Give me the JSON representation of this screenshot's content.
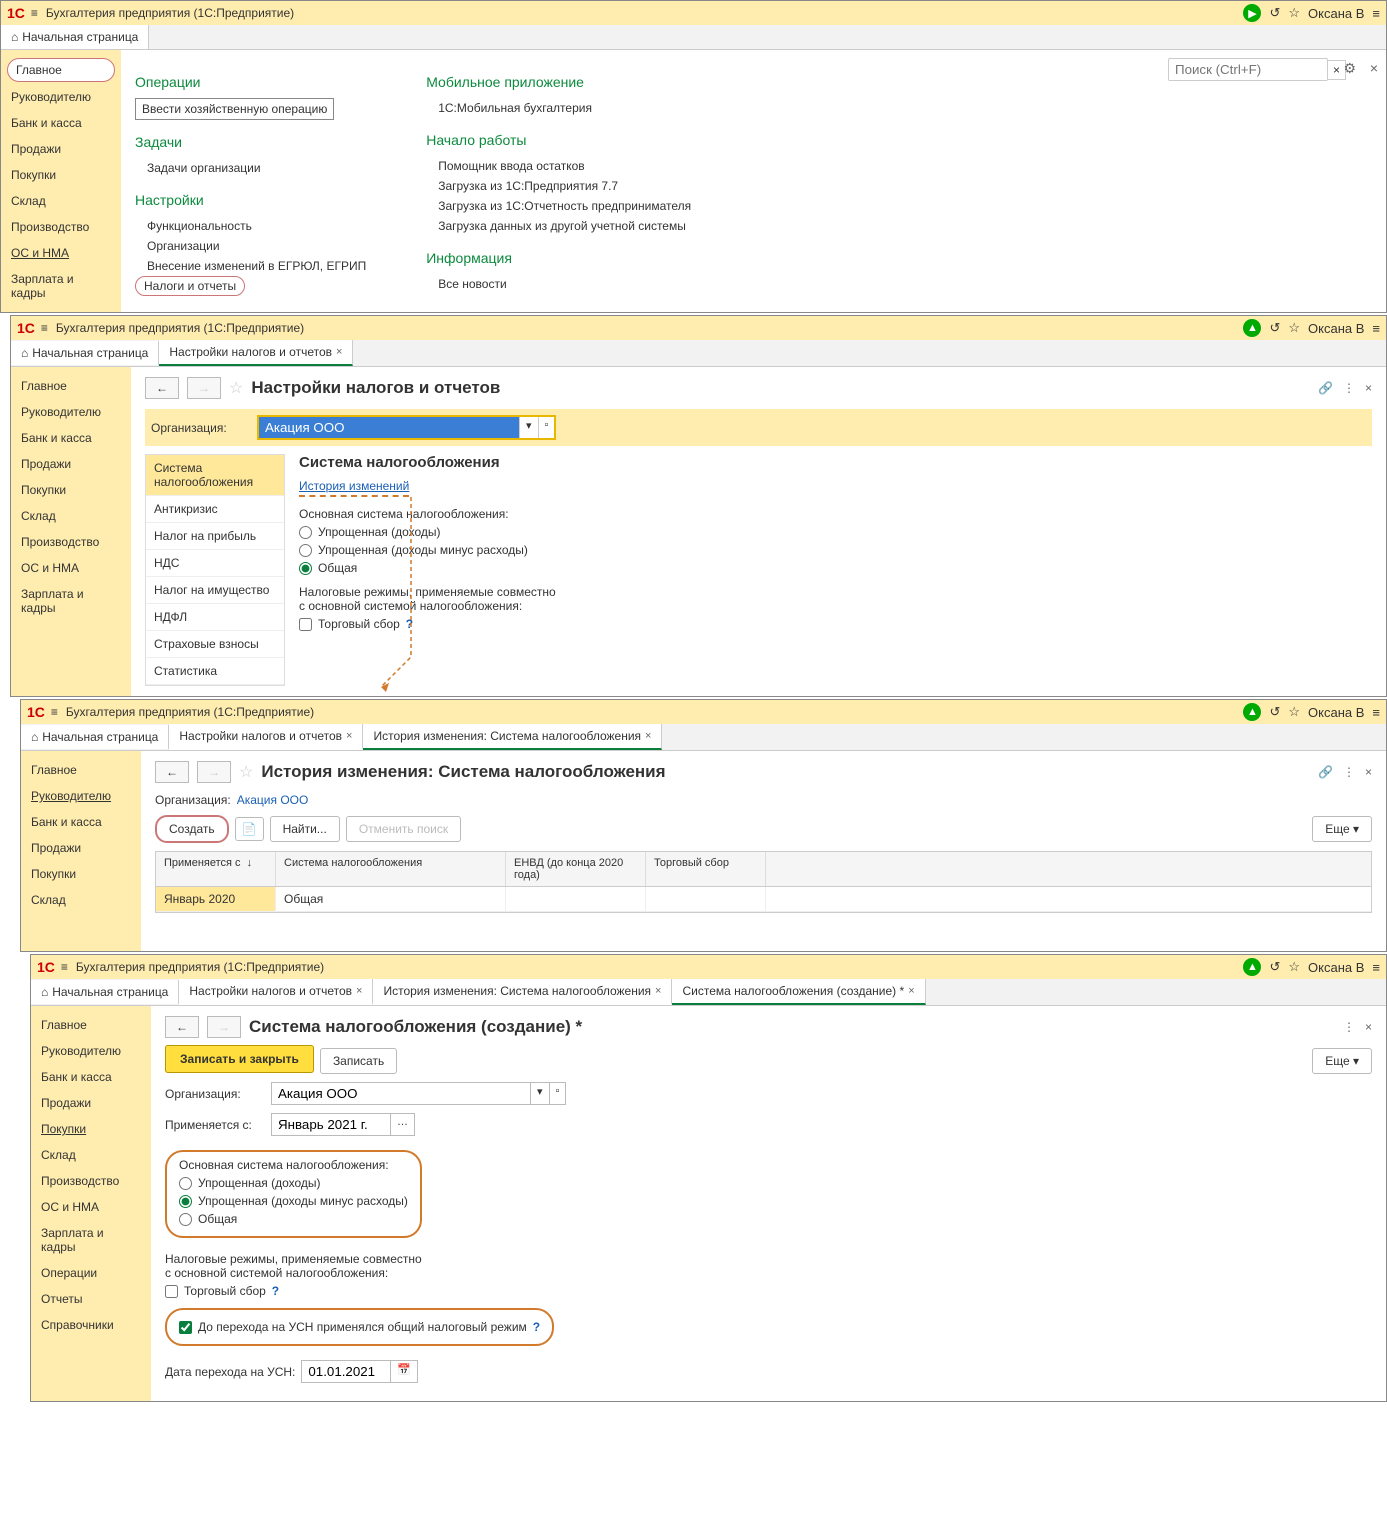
{
  "app_title": "Бухгалтерия предприятия  (1С:Предприятие)",
  "user": "Оксана В",
  "search_placeholder": "Поиск (Ctrl+F)",
  "home_tab": "Начальная страница",
  "sidebar": {
    "items": [
      "Главное",
      "Руководителю",
      "Банк и касса",
      "Продажи",
      "Покупки",
      "Склад",
      "Производство",
      "ОС и НМА",
      "Зарплата и кадры"
    ]
  },
  "sidebar_ext": {
    "items": [
      "Главное",
      "Руководителю",
      "Банк и касса",
      "Продажи",
      "Покупки",
      "Склад",
      "Производство",
      "ОС и НМА",
      "Зарплата и кадры",
      "Операции",
      "Отчеты",
      "Справочники"
    ]
  },
  "main_menu": {
    "operations": {
      "title": "Операции",
      "items": [
        "Ввести хозяйственную операцию"
      ]
    },
    "tasks": {
      "title": "Задачи",
      "items": [
        "Задачи организации"
      ]
    },
    "settings": {
      "title": "Настройки",
      "items": [
        "Функциональность",
        "Организации",
        "Внесение изменений в ЕГРЮЛ, ЕГРИП",
        "Налоги и отчеты"
      ]
    },
    "mobile": {
      "title": "Мобильное приложение",
      "items": [
        "1С:Мобильная бухгалтерия"
      ]
    },
    "start": {
      "title": "Начало работы",
      "items": [
        "Помощник ввода остатков",
        "Загрузка из 1С:Предприятия 7.7",
        "Загрузка из 1С:Отчетность предпринимателя",
        "Загрузка данных из другой учетной системы"
      ]
    },
    "info": {
      "title": "Информация",
      "items": [
        "Все новости"
      ]
    }
  },
  "tax_page": {
    "tab": "Настройки налогов и отчетов",
    "title": "Настройки налогов и отчетов",
    "org_label": "Организация:",
    "org_value": "Акация ООО",
    "nav": [
      "Система налогообложения",
      "Антикризис",
      "Налог на прибыль",
      "НДС",
      "Налог на имущество",
      "НДФЛ",
      "Страховые взносы",
      "Статистика"
    ],
    "section_title": "Система налогообложения",
    "history_link": "История изменений",
    "main_label": "Основная система налогообложения:",
    "opts": [
      "Упрощенная (доходы)",
      "Упрощенная (доходы минус расходы)",
      "Общая"
    ],
    "regimes_label1": "Налоговые режимы, применяемые совместно",
    "regimes_label2": "с основной системой налогообложения:",
    "trade_fee": "Торговый сбор"
  },
  "history_page": {
    "tab": "История изменения: Система налогообложения",
    "title": "История изменения: Система налогообложения",
    "org_label": "Организация:",
    "org_value": "Акация ООО",
    "create": "Создать",
    "find": "Найти...",
    "cancel_find": "Отменить поиск",
    "more": "Еще",
    "cols": [
      "Применяется с",
      "Система налогообложения",
      "ЕНВД (до конца 2020 года)",
      "Торговый сбор"
    ],
    "row": {
      "date": "Январь 2020",
      "system": "Общая"
    }
  },
  "create_page": {
    "tab": "Система налогообложения (создание) *",
    "title": "Система налогообложения (создание) *",
    "save_close": "Записать и закрыть",
    "save": "Записать",
    "more": "Еще",
    "org_label": "Организация:",
    "org_value": "Акация ООО",
    "applies_label": "Применяется с:",
    "applies_value": "Январь 2021 г.",
    "main_label": "Основная система налогообложения:",
    "opts": [
      "Упрощенная (доходы)",
      "Упрощенная (доходы минус расходы)",
      "Общая"
    ],
    "regimes_label1": "Налоговые режимы, применяемые совместно",
    "regimes_label2": "с основной системой налогообложения:",
    "trade_fee": "Торговый сбор",
    "usn_prev": "До перехода на УСН применялся общий налоговый режим",
    "usn_date_label": "Дата перехода на УСН:",
    "usn_date": "01.01.2021"
  }
}
